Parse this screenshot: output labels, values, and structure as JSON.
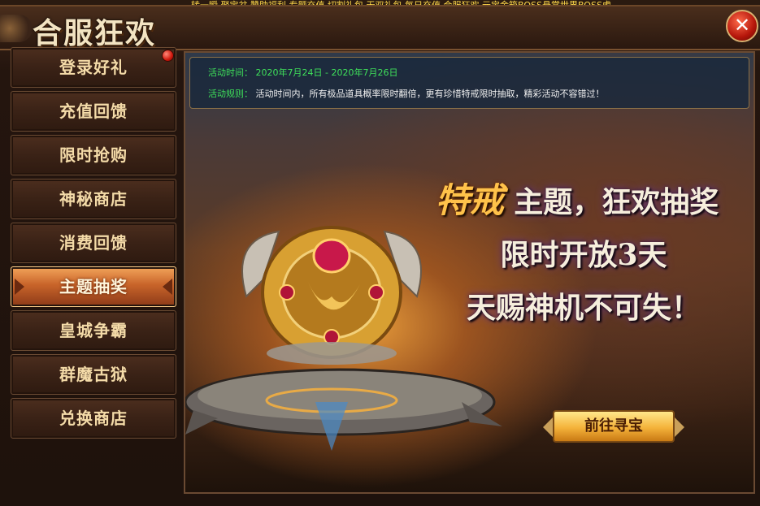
{
  "ticker": "转一瞬   聚宝盆  赞助福利 专题充值 切割礼包 无双礼包 每日充值 合服狂欢 元宝金箱BOSS悬赏世界BOSS虎",
  "window": {
    "title": "合服狂欢",
    "close_symbol": "✕"
  },
  "sidebar": {
    "items": [
      {
        "label": "登录好礼",
        "badge": true
      },
      {
        "label": "充值回馈"
      },
      {
        "label": "限时抢购"
      },
      {
        "label": "神秘商店"
      },
      {
        "label": "消费回馈"
      },
      {
        "label": "主题抽奖",
        "active": true
      },
      {
        "label": "皇城争霸"
      },
      {
        "label": "群魔古狱"
      },
      {
        "label": "兑换商店"
      }
    ]
  },
  "info": {
    "time_label": "活动时间：",
    "time_value": "2020年7月24日 - 2020年7月26日",
    "rules_label": "活动规则：",
    "rules_value": "活动时间内，所有极品道具概率限时翻倍，更有珍惜特戒限时抽取，精彩活动不容错过！"
  },
  "banner": {
    "highlight": "特戒",
    "line1": "主题，狂欢抽奖",
    "line2": "限时开放3天",
    "line3": "天赐神机不可失！"
  },
  "action_button": "前往寻宝",
  "colors": {
    "accent_gold": "#ffc24a",
    "active_tab": "#c8642a",
    "info_green": "#3fe05a",
    "close_red": "#b4150a"
  }
}
